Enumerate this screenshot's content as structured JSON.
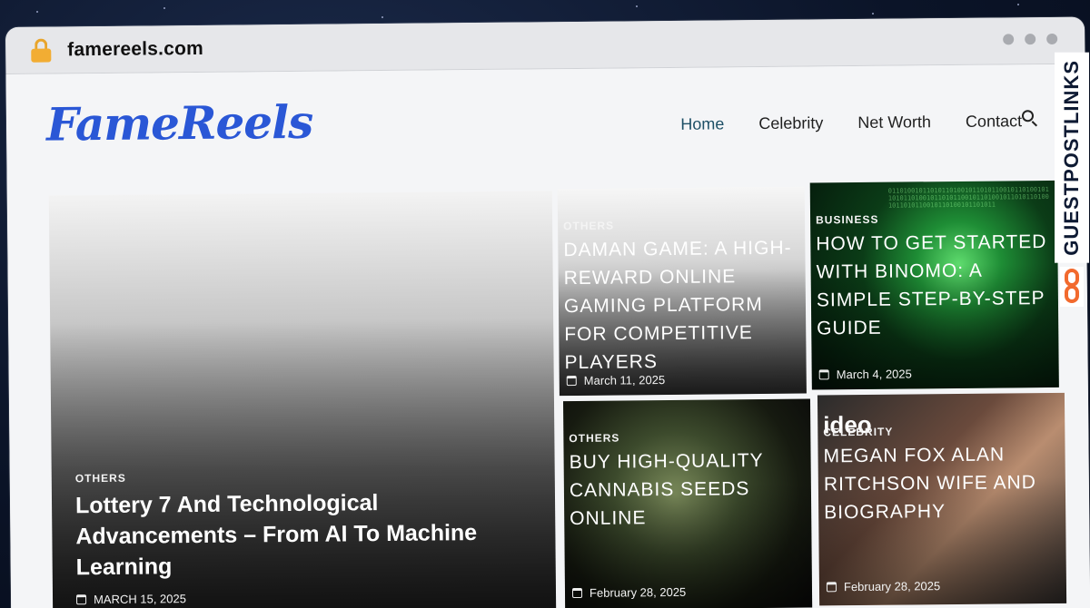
{
  "browser": {
    "url": "famereels.com"
  },
  "site": {
    "logo": "FameReels",
    "nav": [
      {
        "label": "Home",
        "active": true
      },
      {
        "label": "Celebrity",
        "active": false
      },
      {
        "label": "Net Worth",
        "active": false
      },
      {
        "label": "Contact",
        "active": false
      }
    ]
  },
  "featured": {
    "category": "OTHERS",
    "title": "Lottery 7 And Technological Advancements – From AI To Machine Learning",
    "date": "MARCH 15, 2025"
  },
  "cards": [
    {
      "category": "OTHERS",
      "title": "DAMAN GAME: A HIGH-REWARD ONLINE GAMING PLATFORM FOR COMPETITIVE PLAYERS",
      "date": "March 11, 2025"
    },
    {
      "category": "BUSINESS",
      "title": "HOW TO GET STARTED WITH BINOMO: A SIMPLE STEP-BY-STEP GUIDE",
      "date": "March 4, 2025"
    },
    {
      "category": "OTHERS",
      "title": "BUY HIGH-QUALITY CANNABIS SEEDS ONLINE",
      "date": "February 28, 2025"
    },
    {
      "category": "CELEBRITY",
      "title": "MEGAN FOX ALAN RITCHSON WIFE AND BIOGRAPHY",
      "date": "February 28, 2025"
    }
  ],
  "card4_overlay": "ideo",
  "binary_text": "0110100101101011010010110101100101101001011010110100101101011001011010010110101101001011010110010110100101101011",
  "watermark": "GUESTPOSTLINKS",
  "colors": {
    "logo": "#2a57d6",
    "nav_active": "#1d4f66",
    "watermark_accent": "#f26a2e"
  },
  "icons": [
    "lock-icon",
    "search-icon",
    "calendar-icon",
    "link-icon"
  ]
}
